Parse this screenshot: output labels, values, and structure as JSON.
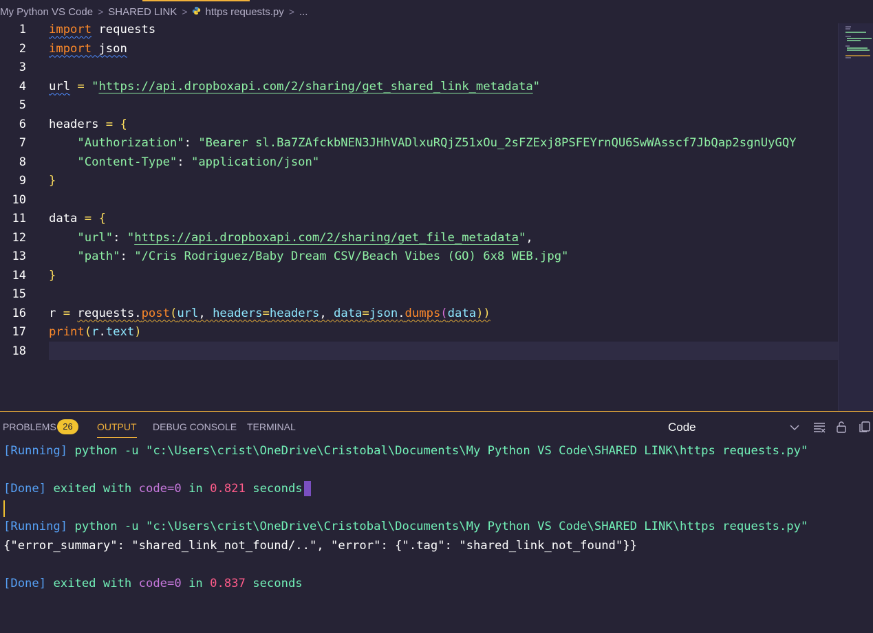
{
  "breadcrumb": {
    "items": [
      "My Python VS Code",
      "SHARED LINK",
      "https requests.py",
      "..."
    ],
    "separator": ">"
  },
  "editor": {
    "line_numbers": [
      "1",
      "2",
      "3",
      "4",
      "5",
      "6",
      "7",
      "8",
      "9",
      "10",
      "11",
      "12",
      "13",
      "14",
      "15",
      "16",
      "17",
      "18"
    ],
    "lines": {
      "l1a": "import",
      "l1b": " requests",
      "l2a": "import",
      "l2b": " json",
      "l4a": "url",
      "l4b": " = ",
      "l4c": "\"",
      "l4d": "https://api.dropboxapi.com/2/sharing/get_shared_link_metadata",
      "l4e": "\"",
      "l6a": "headers",
      "l6b": " = ",
      "l6c": "{",
      "l7a": "    \"Authorization\"",
      "l7b": ": ",
      "l7c": "\"Bearer sl.Ba7ZAfckbNEN3JHhVADlxuRQjZ51xOu_2sFZExj8PSFEYrnQU6SwWAsscf7JbQap2sgnUyGQY",
      "l8a": "    \"Content-Type\"",
      "l8b": ": ",
      "l8c": "\"application/json\"",
      "l9a": "}",
      "l11a": "data",
      "l11b": " = ",
      "l11c": "{",
      "l12a": "    \"url\"",
      "l12b": ": ",
      "l12c": "\"",
      "l12d": "https://api.dropboxapi.com/2/sharing/get_file_metadata",
      "l12e": "\"",
      "l12f": ",",
      "l13a": "    \"path\"",
      "l13b": ": ",
      "l13c": "\"/Cris Rodriguez/Baby Dream CSV/Beach Vibes (GO) 6x8 WEB.jpg\"",
      "l14a": "}",
      "l16a": "r",
      "l16b": " = ",
      "l16c": "requests",
      "l16d": ".",
      "l16e": "post",
      "l16f": "(",
      "l16g": "url",
      "l16h": ", ",
      "l16i": "headers",
      "l16j": "=",
      "l16k": "headers",
      "l16l": ", ",
      "l16m": "data",
      "l16n": "=",
      "l16o": "json",
      "l16p": ".",
      "l16q": "dumps",
      "l16r": "(",
      "l16s": "data",
      "l16t": "))",
      "l17a": "print",
      "l17b": "(",
      "l17c": "r",
      "l17d": ".",
      "l17e": "text",
      "l17f": ")"
    }
  },
  "panel": {
    "tabs": {
      "problems": "PROBLEMS",
      "problems_count": "26",
      "output": "OUTPUT",
      "debug_console": "DEBUG CONSOLE",
      "terminal": "TERMINAL"
    },
    "output_channel": "Code",
    "output_lines": {
      "o1a": "[Running]",
      "o1b": " python -u \"c:\\Users\\crist\\OneDrive\\Cristobal\\Documents\\My Python VS Code\\SHARED LINK\\https requests.py\"",
      "o2a": "[Done]",
      "o2b": " exited with ",
      "o2c": "code=0",
      "o2d": " in ",
      "o2e": "0.821",
      "o2f": " seconds",
      "o3a": "[Running]",
      "o3b": " python -u \"c:\\Users\\crist\\OneDrive\\Cristobal\\Documents\\My Python VS Code\\SHARED LINK\\https requests.py\"",
      "o4": "{\"error_summary\": \"shared_link_not_found/..\", \"error\": {\".tag\": \"shared_link_not_found\"}}",
      "o5a": "[Done]",
      "o5b": " exited with ",
      "o5c": "code=0",
      "o5d": " in ",
      "o5e": "0.837",
      "o5f": " seconds"
    }
  },
  "icons": [
    "python-file-icon",
    "chevron-down-icon",
    "clear-output-icon",
    "lock-icon",
    "copy-icon"
  ],
  "colors": {
    "background": "#262335",
    "accent": "#f1b13a",
    "keyword": "#fe8a2a",
    "string": "#8ff0a4",
    "link_blue": "#56a0f5"
  }
}
